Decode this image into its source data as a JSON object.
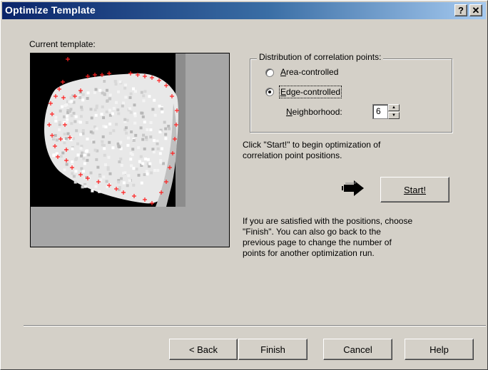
{
  "window": {
    "title": "Optimize Template"
  },
  "titlebar": {
    "help_label": "?",
    "close_label": "✕"
  },
  "template": {
    "label": "Current template:",
    "marker_color": "#ff2020"
  },
  "distribution": {
    "group_label": "Distribution of correlation points:",
    "options": [
      {
        "label": "Area-controlled",
        "selected": false
      },
      {
        "label": "Edge-controlled",
        "selected": true
      }
    ],
    "neighborhood_label": "Neighborhood:",
    "neighborhood_value": "6"
  },
  "start": {
    "instruction": "Click \"Start!\" to begin optimization of\ncorrelation point positions.",
    "button_label": "Start!",
    "arrow_icon": "right-arrow-icon"
  },
  "finish_text": "If you are satisfied with the positions, choose\n\"Finish\". You can also go back to the\nprevious page to change the number of\npoints for another optimization run.",
  "buttons": {
    "back_label": "< Back",
    "finish_label": "Finish",
    "cancel_label": "Cancel",
    "help_label": "Help"
  },
  "colors": {
    "title_start": "#0a246a",
    "title_end": "#a6caf0",
    "face": "#d4d0c8"
  }
}
